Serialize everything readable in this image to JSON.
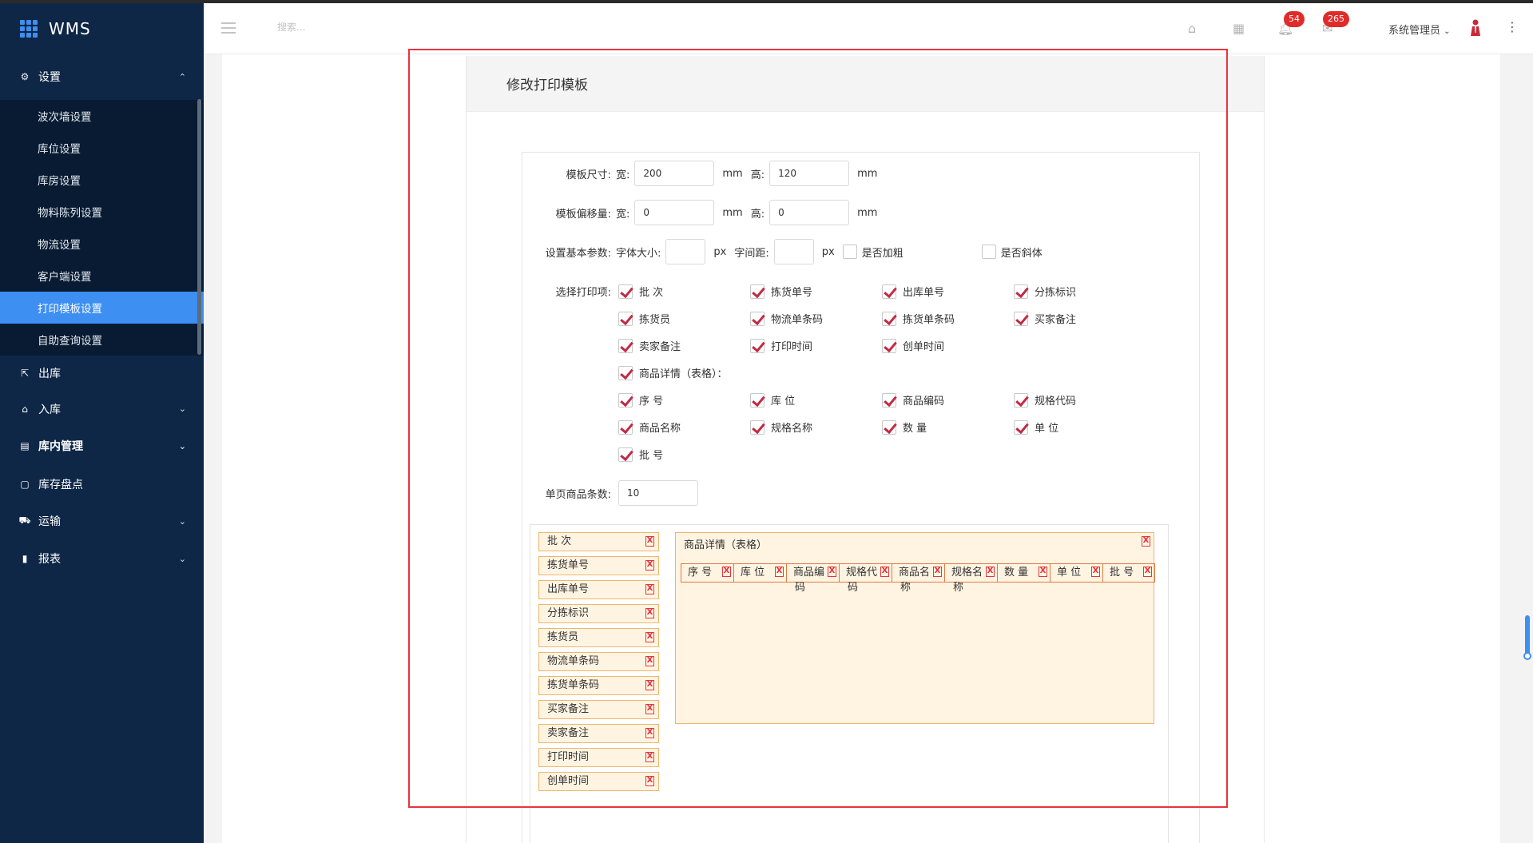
{
  "app": {
    "logo_text": "WMS"
  },
  "sidebar": {
    "settings_group": {
      "label": "设置",
      "items": [
        {
          "label": "波次墙设置",
          "active": false
        },
        {
          "label": "库位设置",
          "active": false
        },
        {
          "label": "库房设置",
          "active": false
        },
        {
          "label": "物料陈列设置",
          "active": false
        },
        {
          "label": "物流设置",
          "active": false
        },
        {
          "label": "客户端设置",
          "active": false
        },
        {
          "label": "打印模板设置",
          "active": true
        },
        {
          "label": "自助查询设置",
          "active": false
        }
      ]
    },
    "items": [
      {
        "label": "出库",
        "icon": "outbound-icon",
        "chevron": false,
        "bold": false
      },
      {
        "label": "入库",
        "icon": "inbound-icon",
        "chevron": true,
        "bold": false
      },
      {
        "label": "库内管理",
        "icon": "warehouse-icon",
        "chevron": true,
        "bold": true
      },
      {
        "label": "库存盘点",
        "icon": "inventory-icon",
        "chevron": false,
        "bold": false
      },
      {
        "label": "运输",
        "icon": "truck-icon",
        "chevron": true,
        "bold": false
      },
      {
        "label": "报表",
        "icon": "chart-icon",
        "chevron": true,
        "bold": false
      }
    ]
  },
  "header": {
    "search_placeholder": "搜索...",
    "notifications_badge": "54",
    "messages_badge": "265",
    "user_name": "系统管理员"
  },
  "panel": {
    "title": "修改打印模板",
    "template_size": {
      "label": "模板尺寸:",
      "width_label": "宽:",
      "width_value": "200",
      "height_label": "高:",
      "height_value": "120",
      "unit": "mm"
    },
    "template_offset": {
      "label": "模板偏移量:",
      "width_label": "宽:",
      "width_value": "0",
      "height_label": "高:",
      "height_value": "0",
      "unit": "mm"
    },
    "basic_params": {
      "label": "设置基本参数:",
      "font_size_label": "字体大小:",
      "font_size_value": "",
      "letter_spacing_label": "字间距:",
      "letter_spacing_value": "",
      "unit": "px",
      "bold_label": "是否加粗",
      "italic_label": "是否斜体"
    },
    "print_items_label": "选择打印项:",
    "print_items": [
      "批 次",
      "拣货单号",
      "出库单号",
      "分拣标识",
      "拣货员",
      "物流单条码",
      "拣货单条码",
      "买家备注",
      "卖家备注",
      "打印时间",
      "创单时间"
    ],
    "detail_table_label": "商品详情（表格）：",
    "detail_columns": [
      "序 号",
      "库 位",
      "商品编码",
      "规格代码",
      "商品名称",
      "规格名称",
      "数 量",
      "单 位",
      "批 号"
    ],
    "page_items": {
      "label": "单页商品条数:",
      "value": "10"
    }
  },
  "preview": {
    "tags": [
      "批 次",
      "拣货单号",
      "出库单号",
      "分拣标识",
      "拣货员",
      "物流单条码",
      "拣货单条码",
      "买家备注",
      "卖家备注",
      "打印时间",
      "创单时间"
    ],
    "table_title": "商品详情（表格）",
    "columns": [
      {
        "top": "序 号",
        "wrap": ""
      },
      {
        "top": "库 位",
        "wrap": ""
      },
      {
        "top": "商品编",
        "wrap": "码"
      },
      {
        "top": "规格代",
        "wrap": "码"
      },
      {
        "top": "商品名",
        "wrap": "称"
      },
      {
        "top": "规格名",
        "wrap": "称"
      },
      {
        "top": "数 量",
        "wrap": ""
      },
      {
        "top": "单 位",
        "wrap": ""
      },
      {
        "top": "批 号",
        "wrap": ""
      }
    ],
    "remove_glyph": "X"
  }
}
